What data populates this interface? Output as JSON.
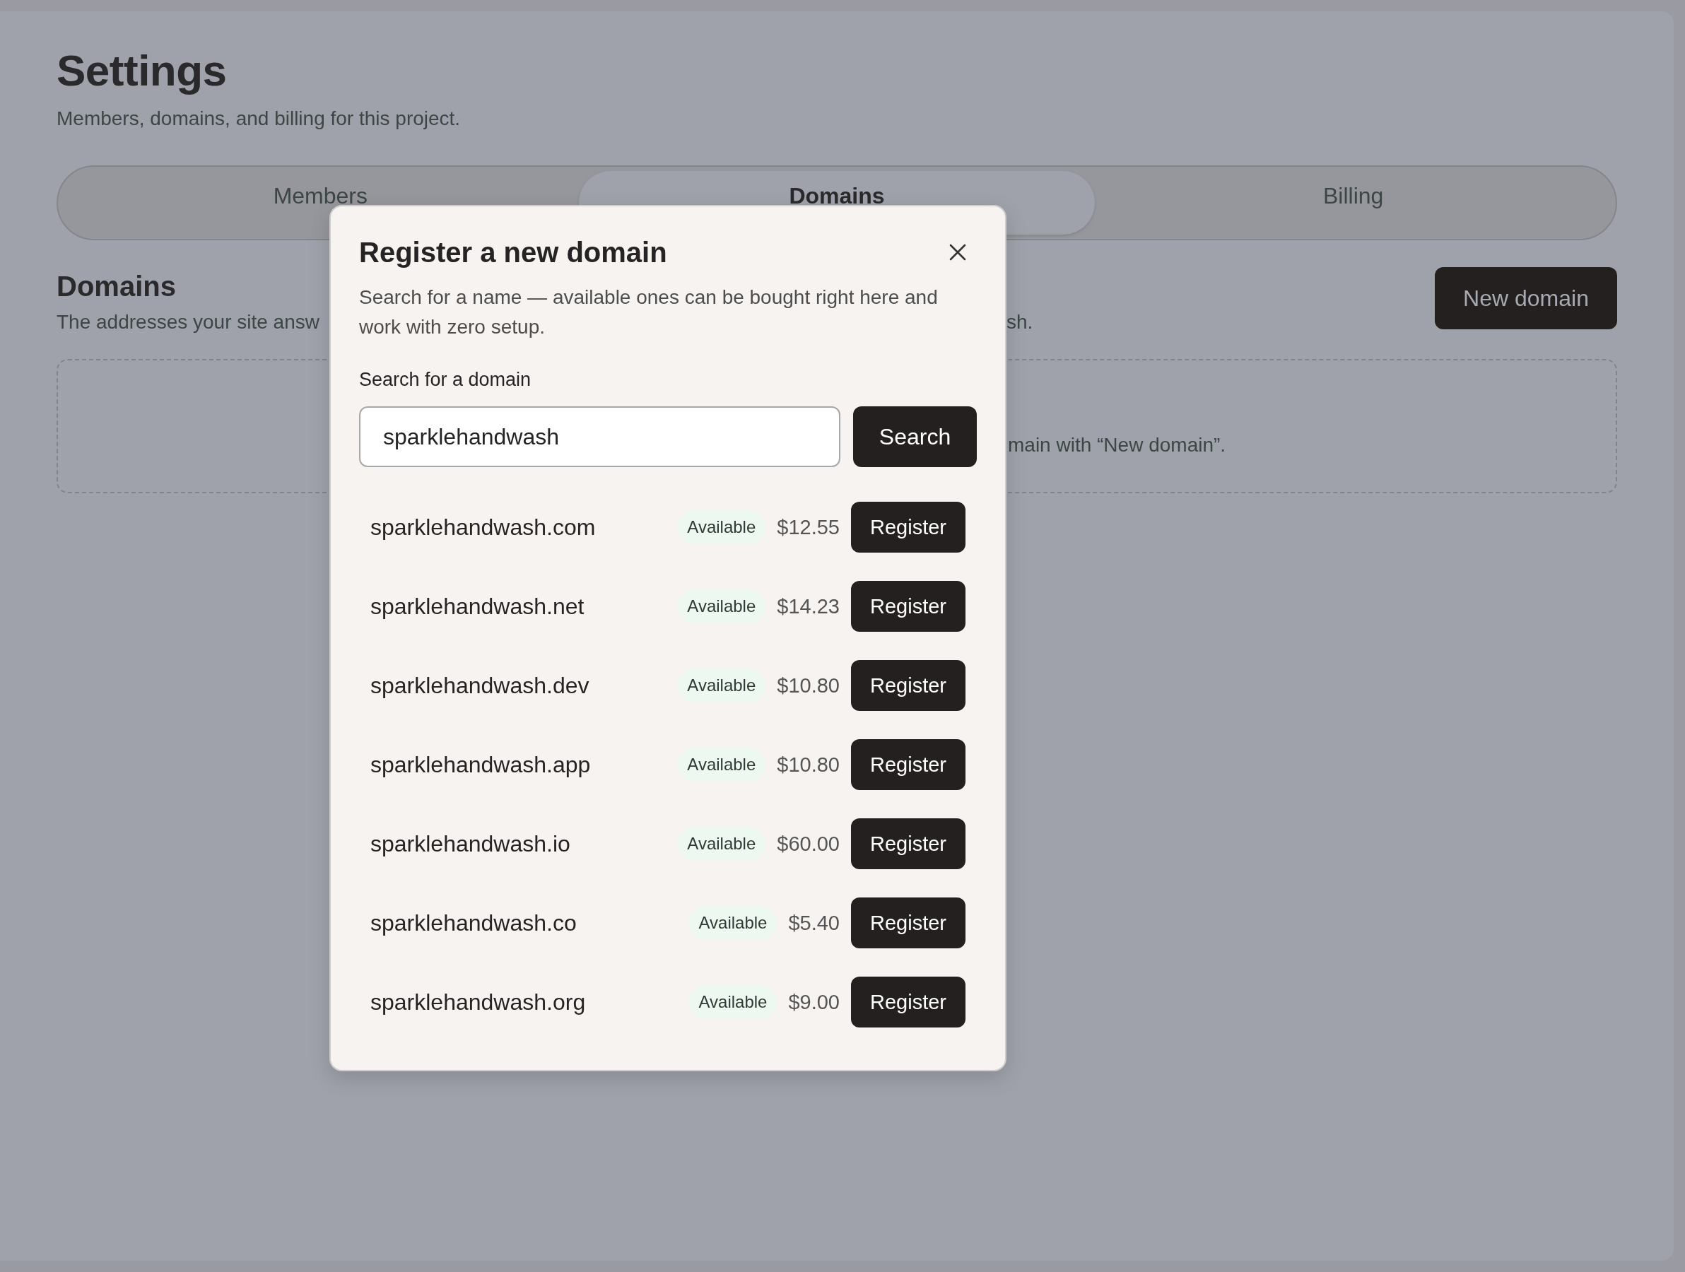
{
  "page": {
    "title": "Settings",
    "subtitle": "Members, domains, and billing for this project."
  },
  "tabs": [
    {
      "label": "Members",
      "selected": false
    },
    {
      "label": "Domains",
      "selected": true
    },
    {
      "label": "Billing",
      "selected": false
    }
  ],
  "section": {
    "title": "Domains",
    "description_left": "The addresses your site answ",
    "description_right": "sh.",
    "new_button": "New domain",
    "empty_state_text": "main with “New domain”."
  },
  "dialog": {
    "title": "Register a new domain",
    "description": "Search for a name — available ones can be bought right here and work with zero setup.",
    "search_label": "Search for a domain",
    "search_value": "sparklehandwash",
    "search_button": "Search",
    "results": [
      {
        "domain": "sparklehandwash.com",
        "status": "Available",
        "price": "$12.55",
        "action": "Register"
      },
      {
        "domain": "sparklehandwash.net",
        "status": "Available",
        "price": "$14.23",
        "action": "Register"
      },
      {
        "domain": "sparklehandwash.dev",
        "status": "Available",
        "price": "$10.80",
        "action": "Register"
      },
      {
        "domain": "sparklehandwash.app",
        "status": "Available",
        "price": "$10.80",
        "action": "Register"
      },
      {
        "domain": "sparklehandwash.io",
        "status": "Available",
        "price": "$60.00",
        "action": "Register"
      },
      {
        "domain": "sparklehandwash.co",
        "status": "Available",
        "price": "$5.40",
        "action": "Register"
      },
      {
        "domain": "sparklehandwash.org",
        "status": "Available",
        "price": "$9.00",
        "action": "Register"
      }
    ]
  }
}
